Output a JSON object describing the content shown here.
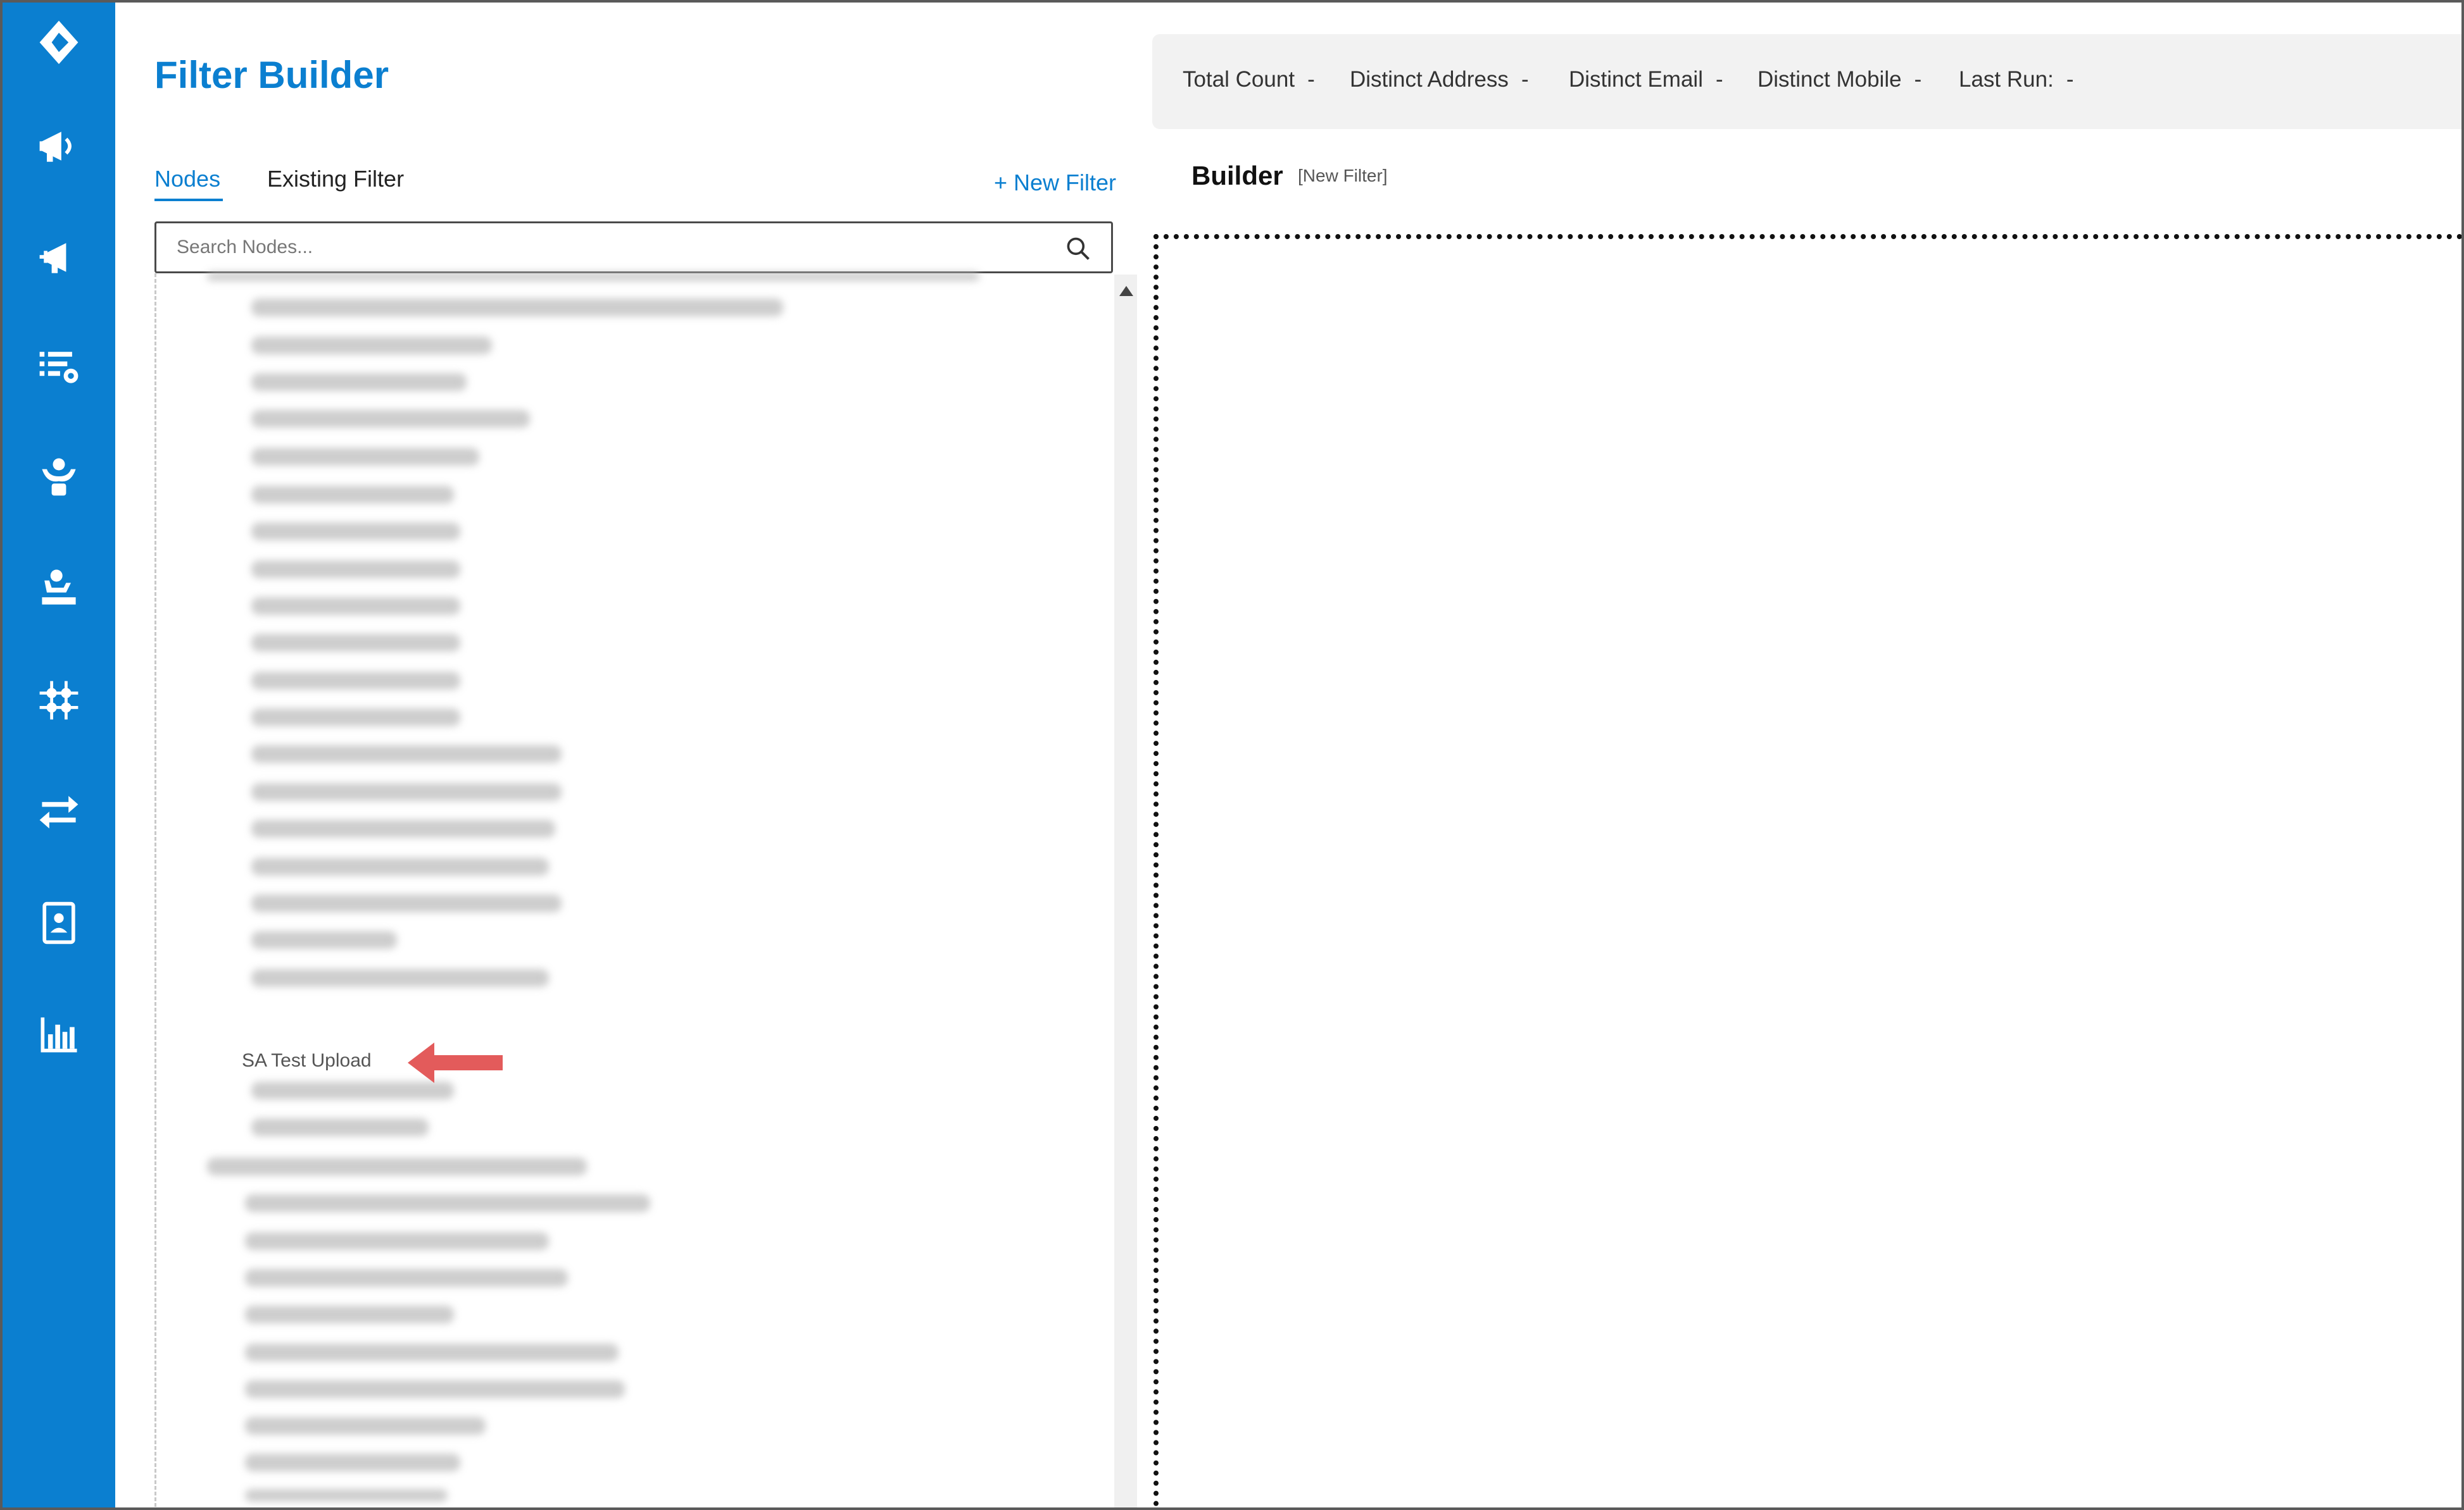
{
  "app": {
    "title": "Filter Builder"
  },
  "sidebar": {
    "items": [
      {
        "icon": "logo-icon"
      },
      {
        "icon": "megaphone-icon"
      },
      {
        "icon": "campaign-add-icon"
      },
      {
        "icon": "list-settings-icon"
      },
      {
        "icon": "user-hands-icon"
      },
      {
        "icon": "user-desk-icon"
      },
      {
        "icon": "network-grid-icon"
      },
      {
        "icon": "transfer-arrows-icon"
      },
      {
        "icon": "contact-card-icon"
      },
      {
        "icon": "bar-chart-icon"
      }
    ]
  },
  "tabs": [
    {
      "label": "Nodes",
      "active": true
    },
    {
      "label": "Existing Filter",
      "active": false
    }
  ],
  "new_filter_label": "+ New Filter",
  "search": {
    "placeholder": "Search Nodes..."
  },
  "tree": {
    "visible_item": "SA Test Upload"
  },
  "stats": {
    "total_count": {
      "label": "Total Count",
      "value": "-"
    },
    "distinct_address": {
      "label": "Distinct Address",
      "value": "-"
    },
    "distinct_email": {
      "label": "Distinct Email",
      "value": "-"
    },
    "distinct_mobile": {
      "label": "Distinct Mobile",
      "value": "-"
    },
    "last_run": {
      "label": "Last Run:",
      "value": "-"
    }
  },
  "builder": {
    "title": "Builder",
    "subtitle": "[New Filter]"
  },
  "colors": {
    "brand": "#0b7fd0",
    "arrow": "#e35b5b"
  }
}
